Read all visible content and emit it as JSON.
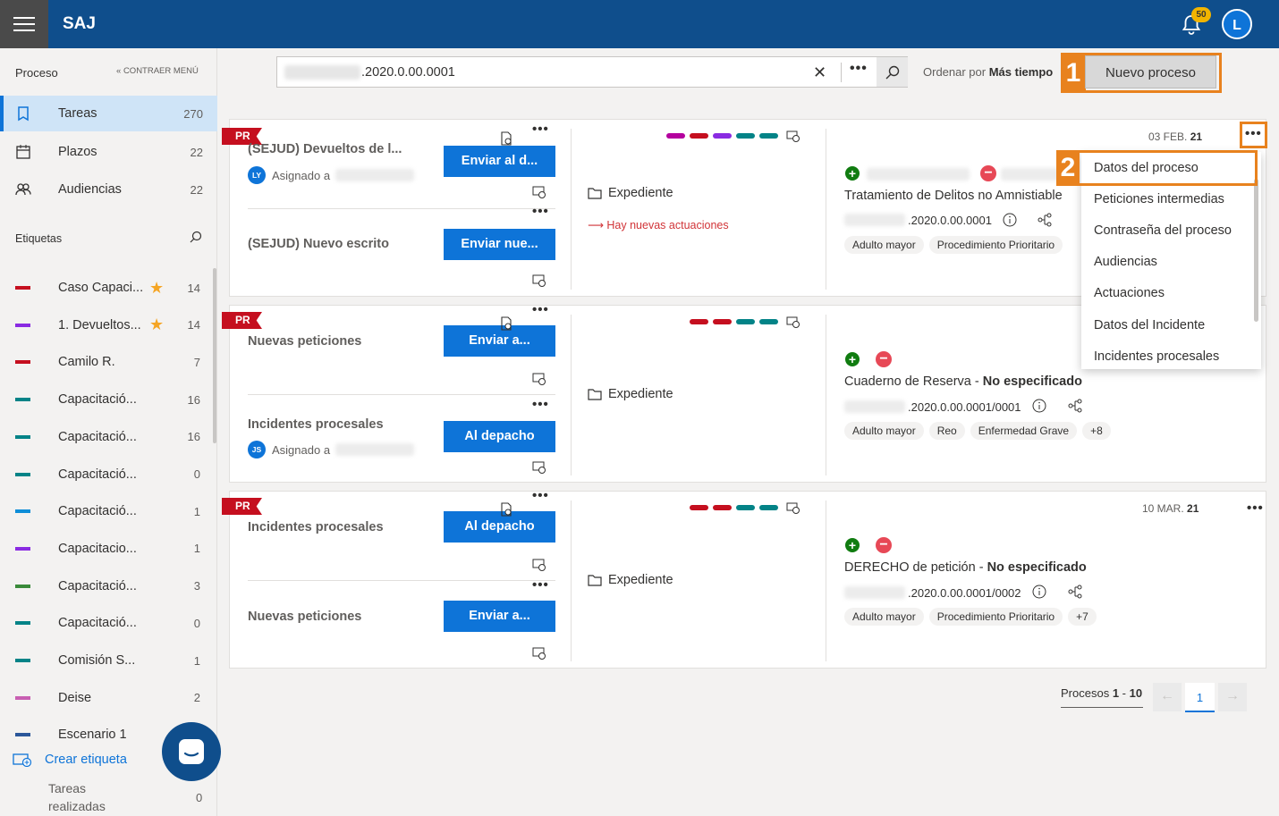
{
  "app": {
    "brand": "SAJ",
    "notifications": "50",
    "user_initial": "L"
  },
  "sidebar": {
    "section": "Proceso",
    "collapse": "CONTRAER MENÚ",
    "nav": [
      {
        "label": "Tareas",
        "count": "270"
      },
      {
        "label": "Plazos",
        "count": "22"
      },
      {
        "label": "Audiencias",
        "count": "22"
      }
    ],
    "tags_title": "Etiquetas",
    "tags": [
      {
        "label": "Caso Capaci...",
        "count": "14",
        "color": "#c50f1f",
        "star": true
      },
      {
        "label": "1. Devueltos...",
        "count": "14",
        "color": "#8a2be2",
        "star": true
      },
      {
        "label": "Camilo R.",
        "count": "7",
        "color": "#c50f1f",
        "star": false
      },
      {
        "label": "Capacitació...",
        "count": "16",
        "color": "#038387",
        "star": false
      },
      {
        "label": "Capacitació...",
        "count": "16",
        "color": "#038387",
        "star": false
      },
      {
        "label": "Capacitació...",
        "count": "0",
        "color": "#038387",
        "star": false
      },
      {
        "label": "Capacitació...",
        "count": "1",
        "color": "#0e8ed8",
        "star": false
      },
      {
        "label": "Capacitacio...",
        "count": "1",
        "color": "#8a2be2",
        "star": false
      },
      {
        "label": "Capacitació...",
        "count": "3",
        "color": "#3a8a3a",
        "star": false
      },
      {
        "label": "Capacitació...",
        "count": "0",
        "color": "#038387",
        "star": false
      },
      {
        "label": "Comisión S...",
        "count": "1",
        "color": "#038387",
        "star": false
      },
      {
        "label": "Deise",
        "count": "2",
        "color": "#c85fb2",
        "star": false
      },
      {
        "label": "Escenario 1",
        "count": "",
        "color": "#2b579a",
        "star": false
      }
    ],
    "create_tag": "Crear etiqueta",
    "done_label": "Tareas realizadas",
    "done_count": "0"
  },
  "search": {
    "value": ".2020.0.00.0001",
    "sort_prefix": "Ordenar por",
    "sort_value": "Más tiempo",
    "new_button": "Nuevo proceso"
  },
  "callouts": {
    "one": "1",
    "two": "2"
  },
  "cards": [
    {
      "tag": "PR",
      "tasks": [
        {
          "title": "(SEJUD) Devueltos de l...",
          "assign_initials": "LY",
          "assign_label": "Asignado a",
          "button": "Enviar al d..."
        },
        {
          "title": "(SEJUD) Nuevo escrito",
          "button": "Enviar nue..."
        }
      ],
      "colors": [
        "#b4009e",
        "#c50f1f",
        "#8a2be2",
        "#038387",
        "#038387"
      ],
      "expediente": "Expediente",
      "new_actions": "Hay nuevas actuaciones",
      "date_prefix": "03 FEB.",
      "date_year": "21",
      "process_title": "Tratamiento de Delitos no Amnistiable",
      "process_number": ".2020.0.00.0001",
      "pills": [
        "Adulto mayor",
        "Procedimiento Prioritario"
      ]
    },
    {
      "tag": "PR",
      "tasks": [
        {
          "title": "Nuevas peticiones",
          "button": "Enviar a..."
        },
        {
          "title": "Incidentes procesales",
          "assign_initials": "JS",
          "assign_label": "Asignado a",
          "button": "Al depacho"
        }
      ],
      "colors": [
        "#c50f1f",
        "#c50f1f",
        "#038387",
        "#038387"
      ],
      "expediente": "Expediente",
      "process_title_main": "Cuaderno de Reserva - ",
      "process_title_bold": "No especificado",
      "process_number": ".2020.0.00.0001/0001",
      "pills": [
        "Adulto mayor",
        "Reo",
        "Enfermedad Grave",
        "+8"
      ]
    },
    {
      "tag": "PR",
      "tasks": [
        {
          "title": "Incidentes procesales",
          "button": "Al depacho"
        },
        {
          "title": "Nuevas peticiones",
          "button": "Enviar a..."
        }
      ],
      "colors": [
        "#c50f1f",
        "#c50f1f",
        "#038387",
        "#038387"
      ],
      "expediente": "Expediente",
      "date_prefix": "10 MAR.",
      "date_year": "21",
      "process_title_main": "DERECHO de petición - ",
      "process_title_bold": "No especificado",
      "process_number": ".2020.0.00.0001/0002",
      "pills": [
        "Adulto mayor",
        "Procedimiento Prioritario",
        "+7"
      ]
    }
  ],
  "menu": [
    "Datos del proceso",
    "Peticiones intermedias",
    "Contraseña del proceso",
    "Audiencias",
    "Actuaciones",
    "Datos del Incidente",
    "Incidentes procesales"
  ],
  "pagination": {
    "label": "Procesos",
    "range_start": "1",
    "range_end": "10",
    "current": "1"
  }
}
